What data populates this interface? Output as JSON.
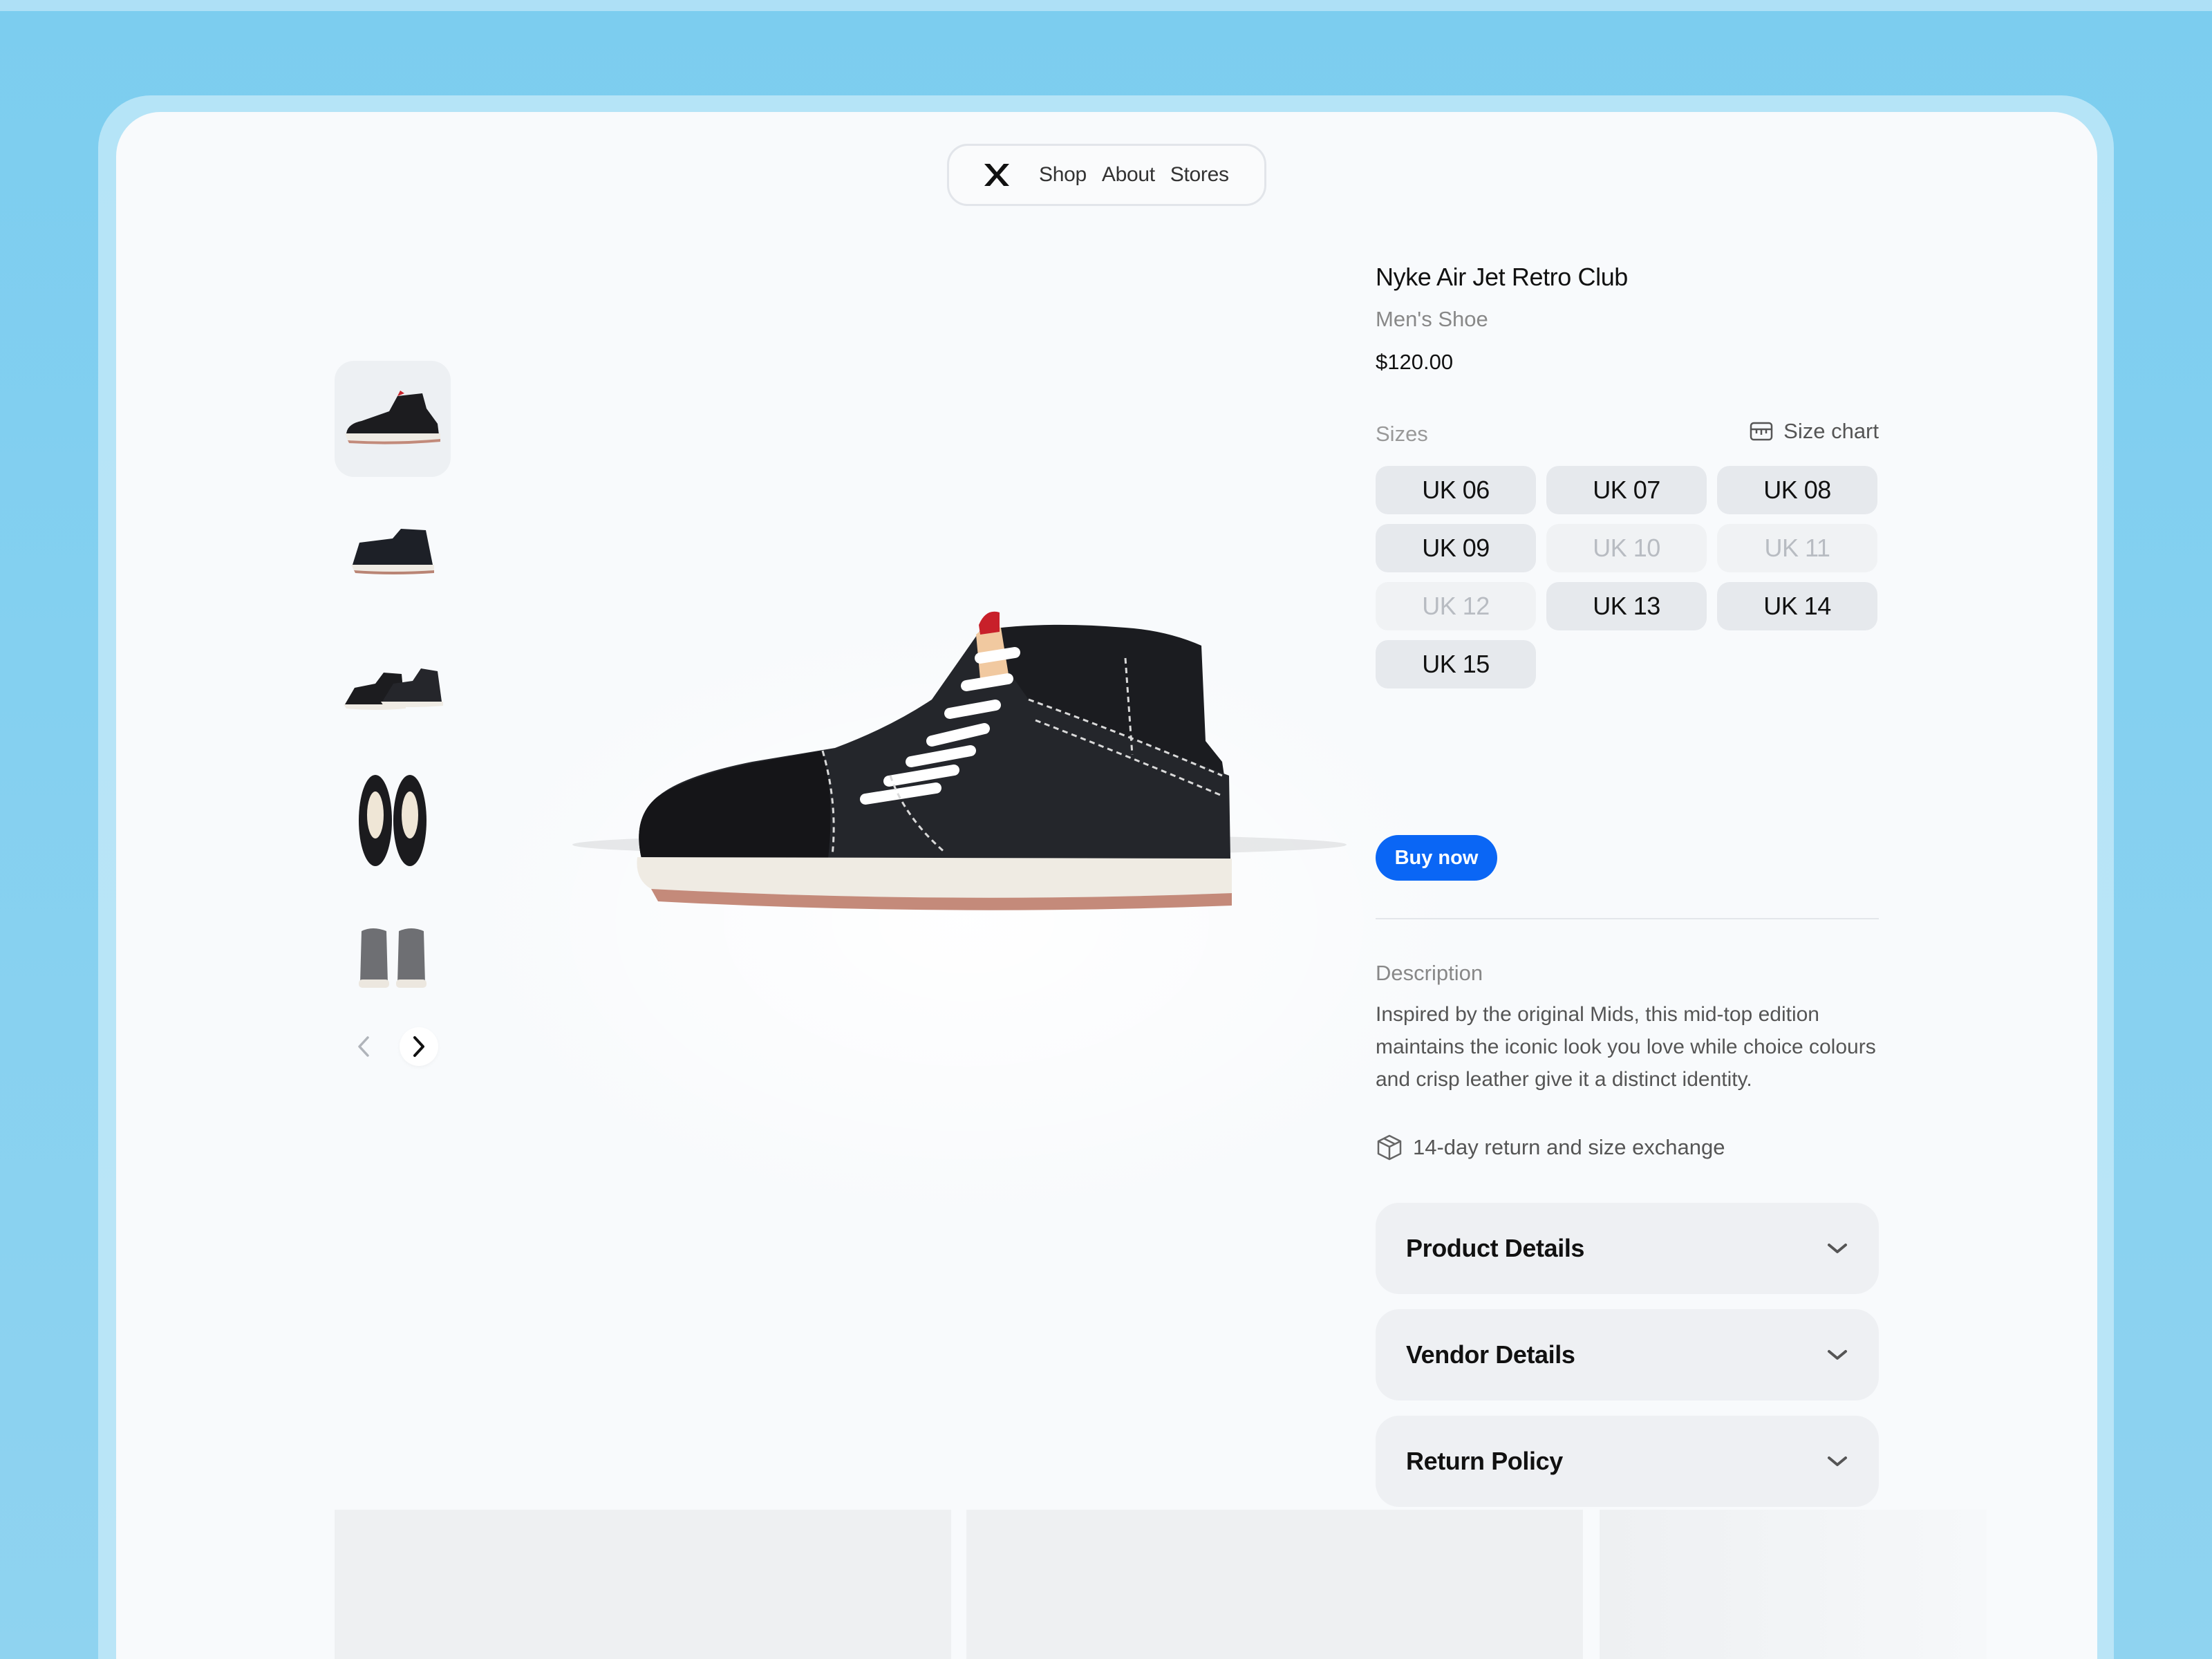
{
  "nav": {
    "logo_icon": "x-logo-icon",
    "links": [
      "Shop",
      "About",
      "Stores"
    ]
  },
  "gallery": {
    "thumbnails": [
      {
        "view": "side-view",
        "active": true
      },
      {
        "view": "side-view-alt",
        "active": false
      },
      {
        "view": "pair-side-view",
        "active": false
      },
      {
        "view": "top-view",
        "active": false
      },
      {
        "view": "back-view",
        "active": false
      }
    ],
    "prev_icon": "chevron-left-icon",
    "next_icon": "chevron-right-icon"
  },
  "product": {
    "title": "Nyke Air Jet Retro Club",
    "subtitle": "Men's Shoe",
    "price": "$120.00",
    "sizes_label": "Sizes",
    "size_chart_label": "Size chart",
    "sizes": [
      {
        "label": "UK 06",
        "available": true
      },
      {
        "label": "UK 07",
        "available": true
      },
      {
        "label": "UK 08",
        "available": true
      },
      {
        "label": "UK 09",
        "available": true
      },
      {
        "label": "UK 10",
        "available": false
      },
      {
        "label": "UK 11",
        "available": false
      },
      {
        "label": "UK 12",
        "available": false
      },
      {
        "label": "UK 13",
        "available": true
      },
      {
        "label": "UK 14",
        "available": true
      },
      {
        "label": "UK 15",
        "available": true
      }
    ],
    "buy_label": "Buy now",
    "description_label": "Description",
    "description": "Inspired by the original Mids, this mid-top edition maintains the iconic look you love while choice colours and crisp leather give it a distinct identity.",
    "returns_text": "14-day return and size exchange",
    "accordions": [
      {
        "label": "Product Details"
      },
      {
        "label": "Vendor Details"
      },
      {
        "label": "Return Policy"
      }
    ]
  },
  "colors": {
    "accent": "#0a66f5",
    "background": "#8fd3f0",
    "card": "#f8fafc"
  }
}
